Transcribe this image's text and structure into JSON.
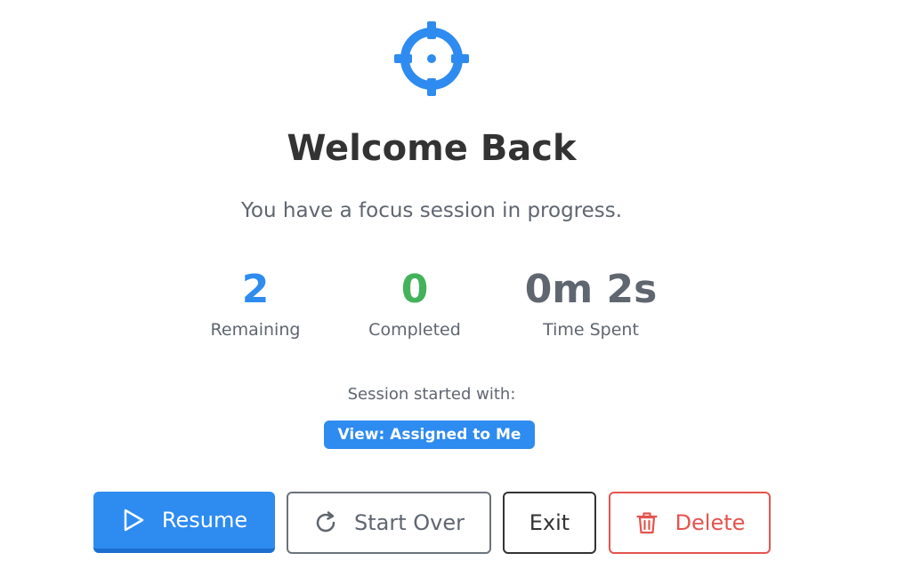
{
  "header": {
    "icon": "crosshair-target-icon",
    "title": "Welcome Back",
    "subtitle": "You have a focus session in progress."
  },
  "stats": [
    {
      "value": "2",
      "label": "Remaining",
      "color": "#2e8bf0"
    },
    {
      "value": "0",
      "label": "Completed",
      "color": "#44b25a"
    },
    {
      "value": "0m 2s",
      "label": "Time Spent",
      "color": "#5f6670"
    }
  ],
  "session": {
    "label": "Session started with:",
    "badge": "View: Assigned to Me"
  },
  "actions": {
    "resume": {
      "label": "Resume",
      "icon": "play-icon"
    },
    "start_over": {
      "label": "Start Over",
      "icon": "restart-icon"
    },
    "exit": {
      "label": "Exit"
    },
    "delete": {
      "label": "Delete",
      "icon": "trash-icon"
    }
  },
  "colors": {
    "accent": "#2e8bf0",
    "success": "#44b25a",
    "danger": "#e5544e",
    "text": "#333333",
    "muted": "#5f6670"
  }
}
